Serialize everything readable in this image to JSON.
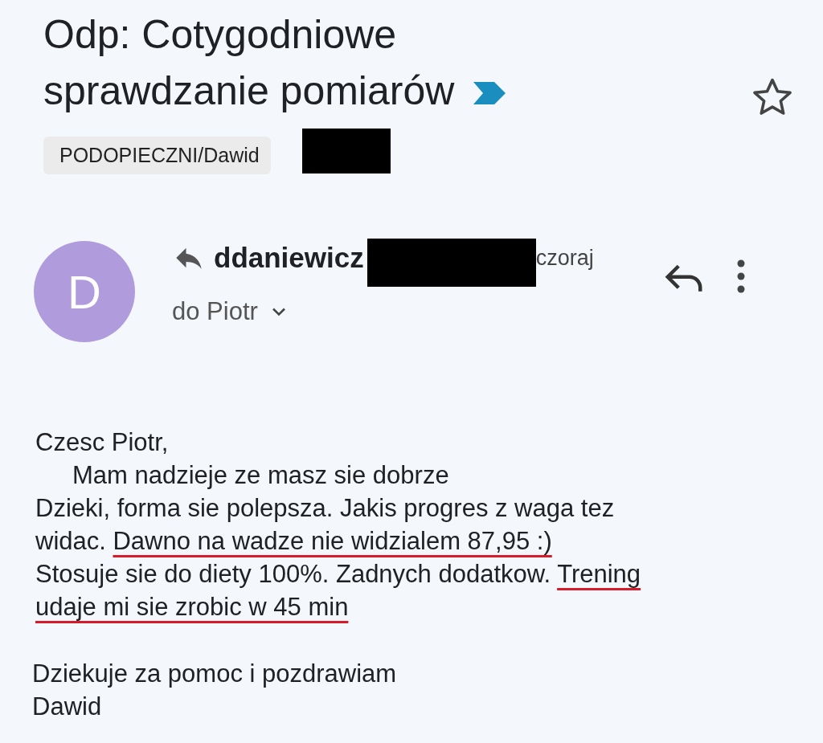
{
  "subject": {
    "title": "Odp: Cotygodniowe sprawdzanie pomiarów",
    "important": true,
    "starred": false
  },
  "label": "PODOPIECZNI/Dawid",
  "message": {
    "avatar_letter": "D",
    "sender": "ddaniewicz",
    "date": "czoraj",
    "recipient": "do Piotr"
  },
  "body": [
    {
      "indent": false,
      "segments": [
        {
          "text": "Czesc Piotr,",
          "underlined": false
        }
      ]
    },
    {
      "indent": true,
      "segments": [
        {
          "text": "Mam nadzieje ze masz sie dobrze",
          "underlined": false
        }
      ]
    },
    {
      "indent": false,
      "segments": [
        {
          "text": "Dzieki, forma sie polepsza. Jakis progres z waga tez",
          "underlined": false
        }
      ]
    },
    {
      "indent": false,
      "segments": [
        {
          "text": "widac. ",
          "underlined": false
        },
        {
          "text": "Dawno na wadze nie widzialem 87,95 :)",
          "underlined": true
        }
      ]
    },
    {
      "indent": false,
      "segments": [
        {
          "text": "Stosuje sie do diety 100%. Zadnych dodatkow. ",
          "underlined": false
        },
        {
          "text": "Trening",
          "underlined": true
        }
      ]
    },
    {
      "indent": false,
      "segments": [
        {
          "text": "udaje mi sie zrobic w 45 min",
          "underlined": true
        }
      ]
    }
  ],
  "signature": [
    "Dziekuje za pomoc i pozdrawiam",
    "Dawid"
  ]
}
